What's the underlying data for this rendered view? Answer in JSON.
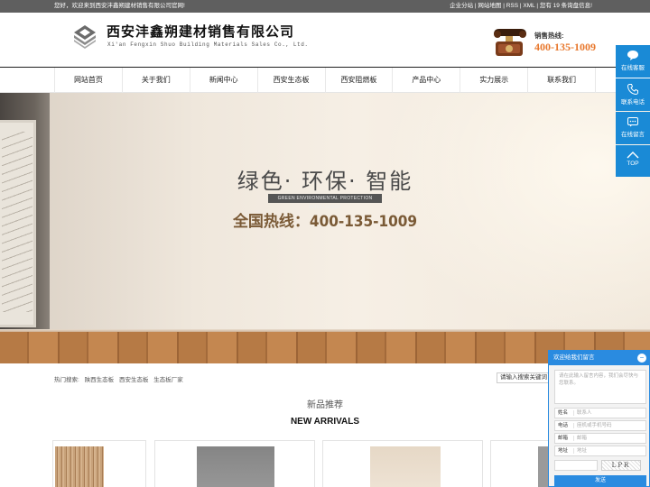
{
  "topbar": {
    "welcome": "您好，欢迎来到西安沣鑫朔建材销售有限公司官网!",
    "links": [
      "企业分站",
      "网站地图",
      "RSS",
      "XML"
    ],
    "messages": "您有 19 条询盘信息!"
  },
  "header": {
    "company_name": "西安沣鑫朔建材销售有限公司",
    "company_en": "Xi'an Fengxin Shuo Building Materials Sales Co., Ltd.",
    "hotline_label": "销售热线:",
    "hotline_number": "400-135-1009"
  },
  "nav": {
    "items": [
      "网站首页",
      "关于我们",
      "新闻中心",
      "西安生态板",
      "西安阻燃板",
      "产品中心",
      "实力展示",
      "联系我们"
    ]
  },
  "banner": {
    "slogan": "绿色· 环保· 智能",
    "slogan_en": "GREEN ENVIRONMENTAL PROTECTION INTELLIGENT",
    "hotline": "全国热线：400-135-1009"
  },
  "search": {
    "hot_label": "热门搜索:",
    "hot_terms": [
      "陕西生态板",
      "西安生态板",
      "生态板厂家"
    ],
    "placeholder": "请输入搜索关键词"
  },
  "section": {
    "title_cn": "新品推荐",
    "title_en": "NEW ARRIVALS"
  },
  "side_bar": {
    "items": [
      {
        "label": "在线客服",
        "icon": "chat-icon"
      },
      {
        "label": "联系电话",
        "icon": "phone-icon"
      },
      {
        "label": "在线留言",
        "icon": "message-icon"
      },
      {
        "label": "TOP",
        "icon": "arrow-up-icon"
      }
    ],
    "color": "#1a8ad6"
  },
  "message_widget": {
    "title": "欢迎给我们留言",
    "close": "−",
    "content_placeholder": "请在此输入留言内容，我们会尽快与您联系。",
    "fields": [
      {
        "label": "姓名",
        "placeholder": "联系人"
      },
      {
        "label": "电话",
        "placeholder": "座机或手机号码"
      },
      {
        "label": "邮箱",
        "placeholder": "邮箱"
      },
      {
        "label": "地址",
        "placeholder": "地址"
      }
    ],
    "captcha": "LPR",
    "send": "发送",
    "color": "#2a8be0"
  }
}
